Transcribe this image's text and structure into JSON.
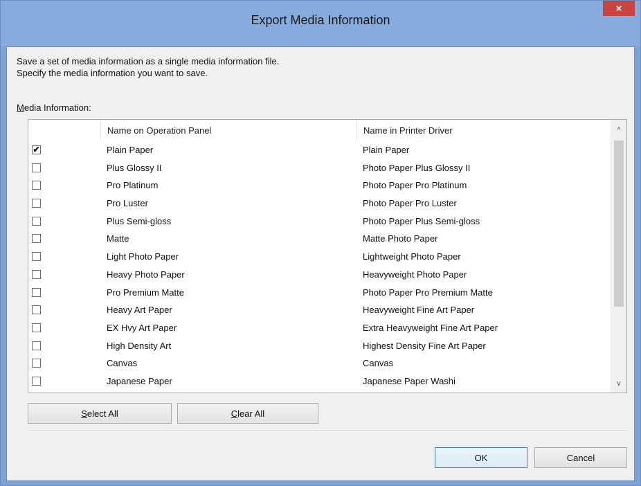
{
  "window": {
    "title": "Export Media Information",
    "close_glyph": "×"
  },
  "description": {
    "line1": "Save a set of media information as a single media information file.",
    "line2": "Specify the media information you want to save."
  },
  "group_label": {
    "mnemonic": "M",
    "rest": "edia Information:"
  },
  "table": {
    "headers": [
      "Name on Operation Panel",
      "Name in Printer Driver"
    ],
    "rows": [
      {
        "checked": true,
        "panel": "Plain Paper",
        "driver": "Plain Paper"
      },
      {
        "checked": false,
        "panel": "Plus Glossy II",
        "driver": "Photo Paper Plus Glossy II"
      },
      {
        "checked": false,
        "panel": "Pro Platinum",
        "driver": "Photo Paper Pro Platinum"
      },
      {
        "checked": false,
        "panel": "Pro Luster",
        "driver": "Photo Paper Pro Luster"
      },
      {
        "checked": false,
        "panel": "Plus Semi-gloss",
        "driver": "Photo Paper Plus Semi-gloss"
      },
      {
        "checked": false,
        "panel": "Matte",
        "driver": "Matte Photo Paper"
      },
      {
        "checked": false,
        "panel": "Light Photo Paper",
        "driver": "Lightweight Photo Paper"
      },
      {
        "checked": false,
        "panel": "Heavy Photo Paper",
        "driver": "Heavyweight Photo Paper"
      },
      {
        "checked": false,
        "panel": "Pro Premium Matte",
        "driver": "Photo Paper Pro Premium Matte"
      },
      {
        "checked": false,
        "panel": "Heavy Art Paper",
        "driver": "Heavyweight Fine Art Paper"
      },
      {
        "checked": false,
        "panel": "EX Hvy Art Paper",
        "driver": "Extra Heavyweight Fine Art Paper"
      },
      {
        "checked": false,
        "panel": "High Density Art",
        "driver": "Highest Density Fine Art Paper"
      },
      {
        "checked": false,
        "panel": "Canvas",
        "driver": "Canvas"
      },
      {
        "checked": false,
        "panel": "Japanese Paper",
        "driver": "Japanese Paper Washi"
      }
    ],
    "check_glyph": "✔",
    "scroll_up_glyph": "^",
    "scroll_down_glyph": "v"
  },
  "buttons": {
    "select_all": {
      "mnemonic": "S",
      "rest": "elect All"
    },
    "clear_all": {
      "mnemonic": "C",
      "rest": "lear All"
    },
    "ok": "OK",
    "cancel": "Cancel"
  },
  "colors": {
    "titlebar": "#86abdc",
    "close_button": "#c7453e",
    "default_button_border": "#3c7fb1"
  }
}
